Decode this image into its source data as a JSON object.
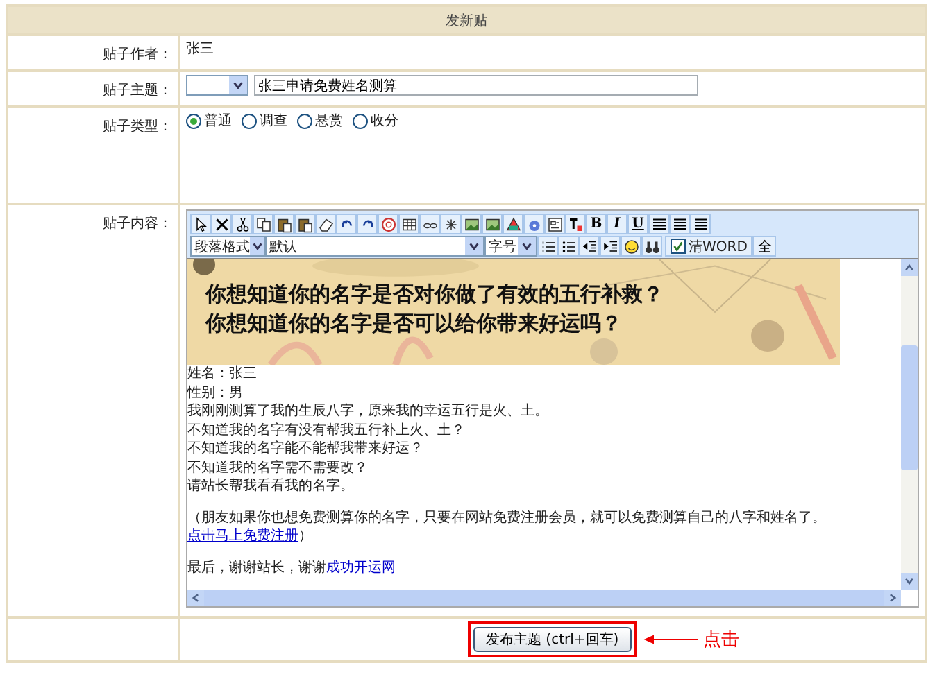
{
  "title": "发新贴",
  "author": {
    "label": "贴子作者：",
    "value": "张三"
  },
  "subject": {
    "label": "贴子主题：",
    "value": "张三申请免费姓名测算"
  },
  "post_type": {
    "label": "贴子类型：",
    "options": [
      {
        "label": "普通",
        "selected": true
      },
      {
        "label": "调查",
        "selected": false
      },
      {
        "label": "悬赏",
        "selected": false
      },
      {
        "label": "收分",
        "selected": false
      }
    ]
  },
  "content": {
    "label": "贴子内容：",
    "format_buttons": [
      "B",
      "I",
      "U"
    ],
    "paragraph_select": "段落格式",
    "font_select": "默认",
    "size_select": "字号",
    "clean_word": {
      "label": "清WORD",
      "checked": true
    },
    "full_button": "全",
    "banner": {
      "kind": "picture",
      "lines": [
        "你想知道你的名字是否对你做了有效的五行补救？",
        "你想知道你的名字是否可以给你带来好运吗？"
      ]
    },
    "lines": [
      "姓名：张三",
      "性别：男",
      "我刚刚测算了我的生辰八字，原来我的幸运五行是火、土。",
      "不知道我的名字有没有帮我五行补上火、土？",
      "不知道我的名字能不能帮我带来好运？",
      "不知道我的名字需不需要改？",
      "请站长帮我看看我的名字。"
    ],
    "note": "（朋友如果你也想免费测算你的名字，只要在网站免费注册会员，就可以免费测算自己的八字和姓名了。",
    "link": "点击马上免费注册",
    "note_end": "）",
    "last_line": "最后，谢谢站长，谢谢",
    "last_link": "成功开运网"
  },
  "submit": {
    "label": "发布主题 (ctrl+回车)",
    "highlighted": true
  },
  "annotation": "点击"
}
